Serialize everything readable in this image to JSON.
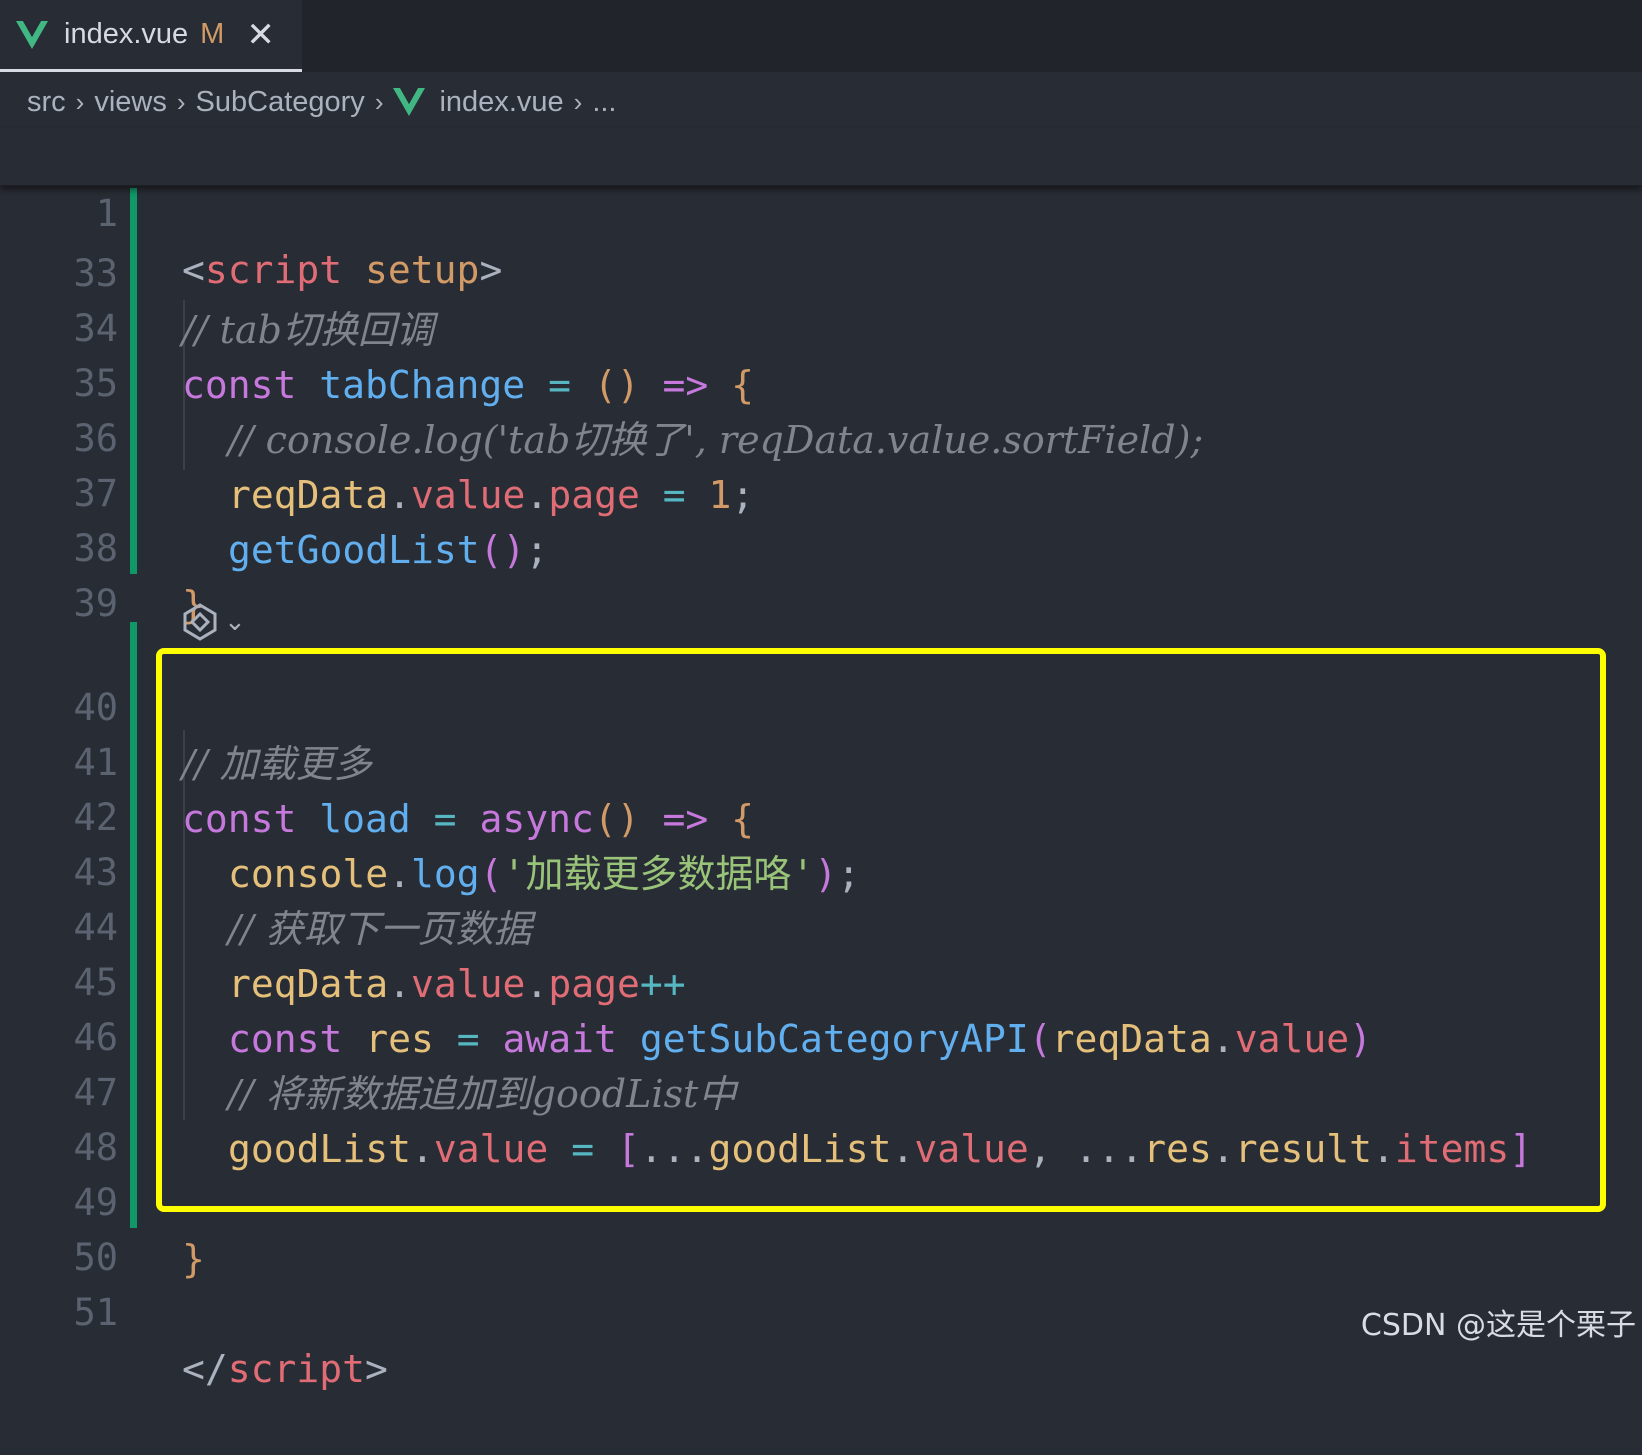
{
  "tab": {
    "filename": "index.vue",
    "status": "M",
    "close": "✕"
  },
  "breadcrumb": {
    "parts": [
      "src",
      "views",
      "SubCategory",
      "index.vue",
      "..."
    ]
  },
  "sticky_line": {
    "number": "1",
    "tag_open": "<",
    "tag_name": "script",
    "attr": " setup",
    "tag_close": ">"
  },
  "lines": [
    {
      "n": "33",
      "comment": "// tab切换回调"
    },
    {
      "n": "34",
      "kw": "const",
      "name": "tabChange",
      "eq": " = ",
      "paren": "()",
      "arrow": " => ",
      "brace": "{"
    },
    {
      "n": "35",
      "comment": "// console.log('tab切换了', reqData.value.sortField);"
    },
    {
      "n": "36",
      "obj": "reqData",
      "dot1": ".",
      "p1": "value",
      "dot2": ".",
      "p2": "page",
      "eq": " = ",
      "num": "1",
      "semi": ";"
    },
    {
      "n": "37",
      "fn": "getGoodList",
      "paren": "()",
      "semi": ";"
    },
    {
      "n": "38",
      "brace": "}"
    },
    {
      "n": "39"
    },
    {
      "n": "40",
      "comment": "// 加载更多"
    },
    {
      "n": "41",
      "kw": "const",
      "name": "load",
      "eq": " = ",
      "async": "async",
      "paren": "()",
      "arrow": " => ",
      "brace": "{"
    },
    {
      "n": "42",
      "obj": "console",
      "dot": ".",
      "fn": "log",
      "po": "(",
      "str": "'加载更多数据咯'",
      "pc": ")",
      "semi": ";"
    },
    {
      "n": "43",
      "comment": "// 获取下一页数据"
    },
    {
      "n": "44",
      "obj": "reqData",
      "dot1": ".",
      "p1": "value",
      "dot2": ".",
      "p2": "page",
      "inc": "++"
    },
    {
      "n": "45",
      "kw": "const",
      "var": " res",
      "eq": " = ",
      "await": "await",
      "fn": " getSubCategoryAPI",
      "po": "(",
      "arg": "reqData",
      "dot": ".",
      "p": "value",
      "pc": ")"
    },
    {
      "n": "46",
      "comment": "// 将新数据追加到goodList中"
    },
    {
      "n": "47",
      "obj": "goodList",
      "dot1": ".",
      "p1": "value",
      "eq": " = ",
      "bo": "[",
      "sp1": "...",
      "o2": "goodList",
      "dot2": ".",
      "p2": "value",
      "comma": ", ",
      "sp2": "...",
      "o3": "res",
      "dot3": ".",
      "p3": "result",
      "dot4": ".",
      "p4": "items",
      "bc": "]"
    },
    {
      "n": "48"
    },
    {
      "n": "49",
      "brace": "}"
    },
    {
      "n": "50"
    },
    {
      "n": "51",
      "tag_open": "</",
      "tag_name": "script",
      "tag_close": ">"
    }
  ],
  "watermark": "CSDN @这是个栗子",
  "colors": {
    "added_gutter": "#109868",
    "highlight_box": "#ffff00",
    "background": "#282c34"
  }
}
